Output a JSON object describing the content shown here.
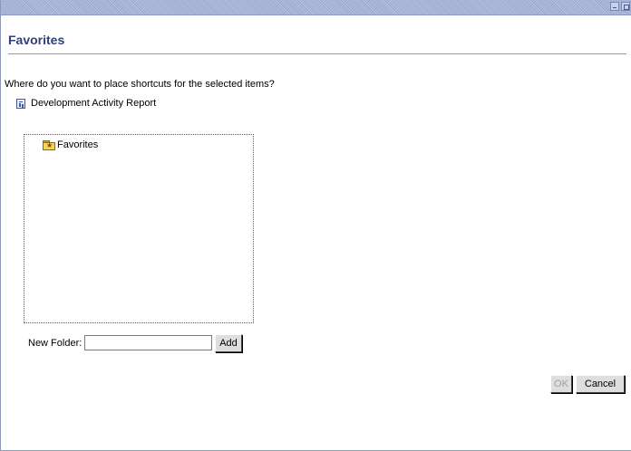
{
  "dialog": {
    "title": "Favorites",
    "question": "Where do you want to place shortcuts for the selected items?",
    "selected_item": {
      "label": "Development Activity Report",
      "icon": "report-icon"
    }
  },
  "tree": {
    "root": {
      "label": "Favorites",
      "icon": "favorites-folder-icon"
    }
  },
  "new_folder": {
    "label": "New Folder:",
    "value": "",
    "add_label": "Add"
  },
  "buttons": {
    "ok_label": "OK",
    "cancel_label": "Cancel",
    "ok_enabled": false
  },
  "colors": {
    "title_text": "#2f3f7c",
    "titlebar": "#a8b3d9"
  }
}
